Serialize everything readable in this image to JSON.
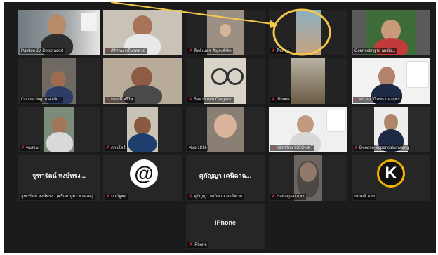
{
  "participants": [
    {
      "name": "Pavitee JV Deepracert",
      "muted": false
    },
    {
      "name": "ศิริรัตน ตรีนาคพงษ์",
      "muted": true
    },
    {
      "name": "ทิพย์เนตร สัญยะพิชิต",
      "muted": true
    },
    {
      "name": "ตีรภัทร",
      "muted": true
    },
    {
      "name": "Connecting to audio...",
      "muted": false
    },
    {
      "name": "Connecting to audio...",
      "muted": false
    },
    {
      "name": "ตนนที ศรีไพ",
      "muted": true
    },
    {
      "name": "Bee Green Oraganic",
      "muted": true
    },
    {
      "name": "iPhone",
      "muted": true
    },
    {
      "name": "ดร.ฉว วิไลพร กองสุพร",
      "muted": true
    },
    {
      "name": "หมดเม",
      "muted": true
    },
    {
      "name": "ดาวโลร์",
      "muted": true
    },
    {
      "name": "vivo 1816",
      "muted": false
    },
    {
      "name": "Mimtrtna SICOMKT",
      "muted": true
    },
    {
      "name": "Deedee Soponsakunwong",
      "muted": true
    },
    {
      "name": "จุฑารัตน์ หงษ์ทรง...(ตรีเอนปูมา ทะหลอ)",
      "muted": false,
      "big_name": "จุฑารัตน์ หงษ์ทรง..."
    },
    {
      "name": "ม.ณัฐพล",
      "muted": true
    },
    {
      "name": "ศุภัญญา เคนิดาฉ ดอนิดาด",
      "muted": true,
      "big_name": "ศุภัญญา เคนิดาฉ..."
    },
    {
      "name": "Hathaipan  แสง",
      "muted": true
    },
    {
      "name": "กฤษณ์ แสง",
      "muted": false
    },
    {
      "name": "iPhone",
      "muted": true,
      "big_name": "iPhone"
    }
  ],
  "colors": {
    "mute": "#e53935",
    "speaker_border": "#d4e157",
    "annotation": "#f5c84c"
  }
}
